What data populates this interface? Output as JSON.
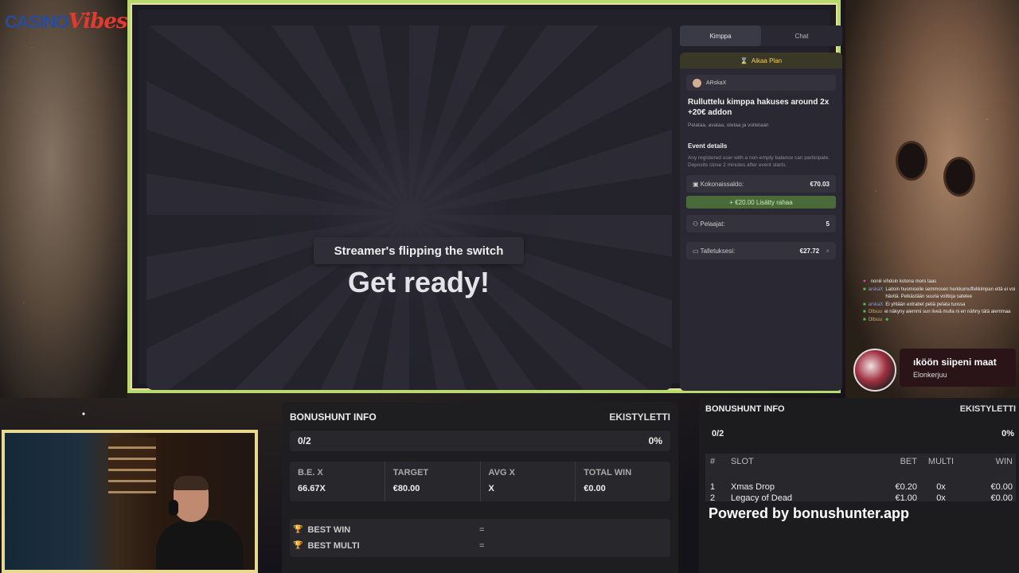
{
  "logo": {
    "part1": "CASINO",
    "part2": "Vibes"
  },
  "game": {
    "banner": "Streamer's flipping the switch",
    "headline": "Get ready!",
    "tabs": [
      {
        "label": "Kimppa",
        "active": true
      },
      {
        "label": "Chat",
        "active": false
      }
    ],
    "plan_header": "Aikaa Plan",
    "user": "ARskaX",
    "plan_title": "Rulluttelu kimppa hakuses around 2x +20€ addon",
    "plan_subtitle": "Pelataa, avataa, oletaa ja voitetaan",
    "event_details_title": "Event details",
    "event_details_text": "Any registered user with a non-empty balance can participate. Deposits close 2 minutes after event starts.",
    "total_balance_label": "Kokonaissaldo:",
    "total_balance_value": "€70.03",
    "addon_label": "+ €20.00 Lisätty rahaa",
    "players_label": "Pelaajat:",
    "players_value": "5",
    "deposits_label": "Talletuksesi:",
    "deposits_value": "€27.72",
    "deposits_close": "×"
  },
  "chat": [
    {
      "user": "",
      "text": "noniii vihdoin kotona moro taas",
      "user_color": "#8aa0d8"
    },
    {
      "user": "arskaX",
      "text": "Laitoin huomiselle semmosen herkkumuffelikimpan että ei voi hävitä. Pelkästään suuria voittoja satelee",
      "user_color": "#8aa0d8"
    },
    {
      "user": "arskaX",
      "text": "Ei yhtään extrabet peliä pelata tuossa",
      "user_color": "#8aa0d8"
    },
    {
      "user": "Oltsuu",
      "text": "ei näkyny aiemmi sun liveä mulla ni en nähny tätä aiemmaa",
      "user_color": "#d6b060"
    },
    {
      "user": "Oltsuu",
      "text": "",
      "user_color": "#d6b060"
    }
  ],
  "alert": {
    "title": "ıköön siipeni maat",
    "subtitle": "Elonkerjuu"
  },
  "bonushunt1": {
    "title": "BONUSHUNT INFO",
    "user": "EKISTYLETTI",
    "progress": "0/2",
    "percent": "0%",
    "stats": [
      {
        "label": "B.E. X",
        "value": "66.67X"
      },
      {
        "label": "TARGET",
        "value": "€80.00"
      },
      {
        "label": "AVG X",
        "value": "X"
      },
      {
        "label": "TOTAL WIN",
        "value": "€0.00"
      }
    ],
    "best_win_label": "BEST WIN",
    "best_win_value": "=",
    "best_multi_label": "BEST MULTI",
    "best_multi_value": "="
  },
  "bonushunt2": {
    "title": "BONUSHUNT INFO",
    "user": "EKISTYLETTI",
    "progress": "0/2",
    "percent": "0%",
    "headers": {
      "num": "#",
      "slot": "SLOT",
      "bet": "BET",
      "multi": "MULTI",
      "win": "WIN"
    },
    "rows": [
      {
        "num": "1",
        "slot": "Xmas Drop",
        "bet": "€0.20",
        "multi": "0x",
        "win": "€0.00"
      },
      {
        "num": "2",
        "slot": "Legacy of Dead",
        "bet": "€1.00",
        "multi": "0x",
        "win": "€0.00"
      }
    ],
    "powered": "Powered by bonushunter.app"
  },
  "colors": {
    "frame": "#b8d870",
    "accent_green": "#4a6a3a",
    "gold": "#f0d060"
  }
}
